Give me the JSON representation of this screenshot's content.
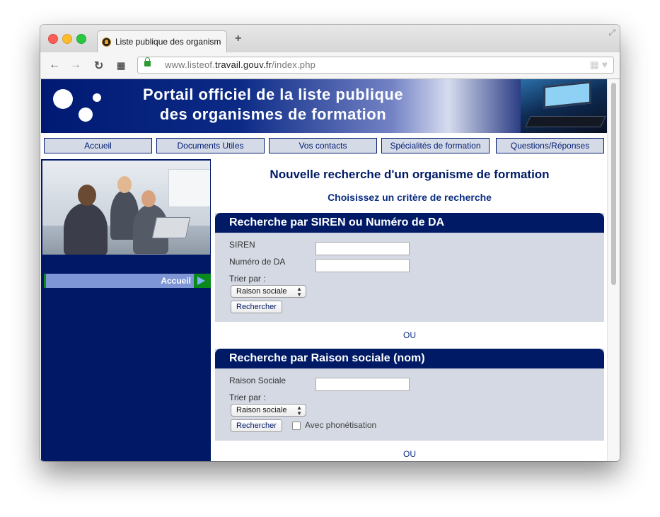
{
  "browser": {
    "tab_title": "Liste publique des organismes",
    "new_tab": "+",
    "url_prefix": "www.listeof.",
    "url_host": "travail.gouv.fr",
    "url_path": "/index.php"
  },
  "banner": {
    "title_line1": "Portail officiel de la liste publique",
    "title_line2": "des organismes de formation"
  },
  "menu": [
    "Accueil",
    "Documents Utiles",
    "Vos contacts",
    "Spécialités de formation",
    "Questions/Réponses"
  ],
  "sidebar": {
    "accueil_label": "Accueil"
  },
  "main": {
    "title": "Nouvelle recherche d'un organisme de formation",
    "subtitle": "Choisissez un critère de recherche",
    "or_label": "OU",
    "panel1": {
      "header": "Recherche par SIREN ou Numéro de DA",
      "siren_label": "SIREN",
      "siren_value": "",
      "da_label": "Numéro de DA",
      "da_value": "",
      "sort_label": "Trier par :",
      "sort_value": "Raison sociale",
      "search_button": "Rechercher"
    },
    "panel2": {
      "header": "Recherche par Raison sociale (nom)",
      "name_label": "Raison Sociale",
      "name_value": "",
      "sort_label": "Trier par :",
      "sort_value": "Raison sociale",
      "search_button": "Rechercher",
      "phonetic_label": "Avec phonétisation",
      "phonetic_checked": false
    }
  },
  "colors": {
    "brand_navy": "#001a66",
    "panel_bg": "#d4d9e3",
    "menu_bg": "#d4dbe6"
  }
}
